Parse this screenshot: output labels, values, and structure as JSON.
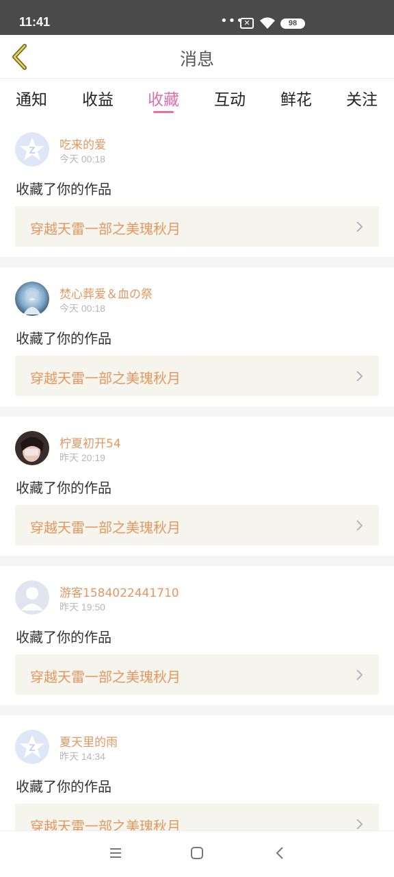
{
  "status_bar": {
    "time": "11:41",
    "dots": "•••",
    "sim_badge": "✕",
    "battery": "98"
  },
  "header": {
    "title": "消息"
  },
  "tabs": [
    {
      "label": "通知"
    },
    {
      "label": "收益"
    },
    {
      "label": "收藏"
    },
    {
      "label": "互动"
    },
    {
      "label": "鲜花"
    },
    {
      "label": "关注"
    }
  ],
  "active_tab": "收藏",
  "accent_color": "#e070a9",
  "name_color": "#e49760",
  "items": [
    {
      "avatar": "qq-default-avatar",
      "name": "吃来的爱",
      "time": "今天 00:18",
      "action": "收藏了你的作品",
      "work": "穿越天雷一部之美瑰秋月"
    },
    {
      "avatar": "anime-avatar",
      "name": "焚心葬爱＆血の祭",
      "time": "今天 00:18",
      "action": "收藏了你的作品",
      "work": "穿越天雷一部之美瑰秋月"
    },
    {
      "avatar": "photo-avatar",
      "name": "柠夏初开54",
      "time": "昨天 20:19",
      "action": "收藏了你的作品",
      "work": "穿越天雷一部之美瑰秋月"
    },
    {
      "avatar": "guest-avatar",
      "name": "游客1584022441710",
      "time": "昨天 19:50",
      "action": "收藏了你的作品",
      "work": "穿越天雷一部之美瑰秋月"
    },
    {
      "avatar": "qq-default-avatar",
      "name": "夏天里的雨",
      "time": "昨天 14:34",
      "action": "收藏了你的作品",
      "work": "穿越天雷一部之美瑰秋月"
    }
  ],
  "system_nav": {
    "menu_icon": "menu-icon",
    "home_icon": "home-icon",
    "back_icon": "back-icon"
  }
}
